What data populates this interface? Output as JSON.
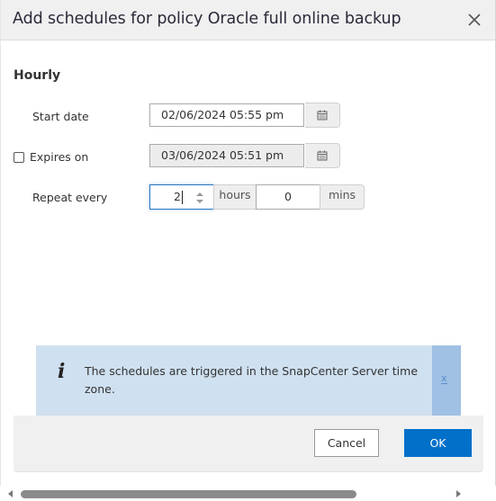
{
  "dialog": {
    "title": "Add schedules for policy Oracle full online backup",
    "close_icon": "close-icon"
  },
  "form": {
    "section_title": "Hourly",
    "start_date": {
      "label": "Start date",
      "value": "02/06/2024 05:55 pm",
      "icon": "calendar-icon"
    },
    "expires_on": {
      "label": "Expires on",
      "checked": false,
      "value": "03/06/2024 05:51 pm",
      "disabled": true,
      "icon": "calendar-icon"
    },
    "repeat_every": {
      "label": "Repeat every",
      "hours_value": "2",
      "hours_unit": "hours",
      "mins_value": "0",
      "mins_unit": "mins"
    }
  },
  "alert": {
    "icon": "info-icon",
    "icon_glyph": "i",
    "message": "The schedules are triggered in the SnapCenter Server time zone.",
    "dismiss_label": "x"
  },
  "footer": {
    "cancel_label": "Cancel",
    "ok_label": "OK"
  },
  "colors": {
    "primary": "#0070c9",
    "alert_bg": "#cfe0f0",
    "alert_close_bg": "#a0c0e4",
    "header_bg": "#f0f0f0"
  }
}
